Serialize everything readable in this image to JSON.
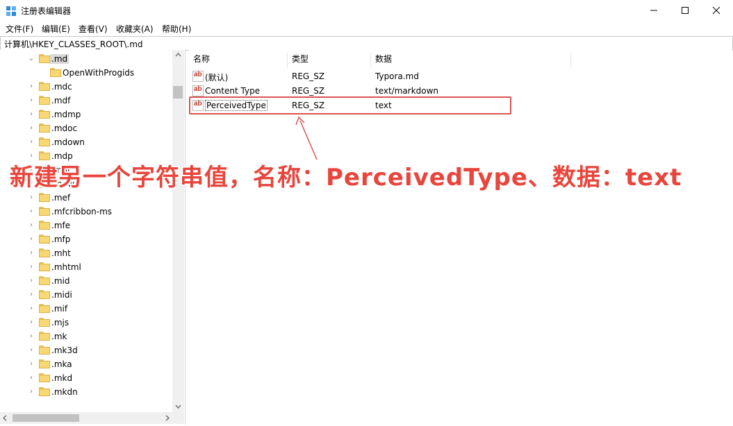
{
  "window": {
    "title": "注册表编辑器"
  },
  "menu": [
    "文件(F)",
    "编辑(E)",
    "查看(V)",
    "收藏夹(A)",
    "帮助(H)"
  ],
  "address": "计算机\\HKEY_CLASSES_ROOT\\.md",
  "tree": {
    "selected": ".md",
    "child": "OpenWithProgids",
    "items": [
      ".mdc",
      ".mdf",
      ".mdmp",
      ".mdoc",
      ".mdown",
      ".mdp",
      ".mdt",
      ".mdwn",
      ".mef",
      ".mfcribbon-ms",
      ".mfe",
      ".mfp",
      ".mht",
      ".mhtml",
      ".mid",
      ".midi",
      ".mif",
      ".mjs",
      ".mk",
      ".mk3d",
      ".mka",
      ".mkd",
      ".mkdn"
    ]
  },
  "columns": {
    "name": "名称",
    "type": "类型",
    "data": "数据"
  },
  "values": [
    {
      "name": "(默认)",
      "type": "REG_SZ",
      "data": "Typora.md"
    },
    {
      "name": "Content Type",
      "type": "REG_SZ",
      "data": "text/markdown"
    },
    {
      "name": "PerceivedType",
      "type": "REG_SZ",
      "data": "text"
    }
  ],
  "annotation": "新建另一个字符串值，名称：PerceivedType、数据：text",
  "colors": {
    "accent": "#e8453c",
    "highlight": "#d9534f"
  }
}
